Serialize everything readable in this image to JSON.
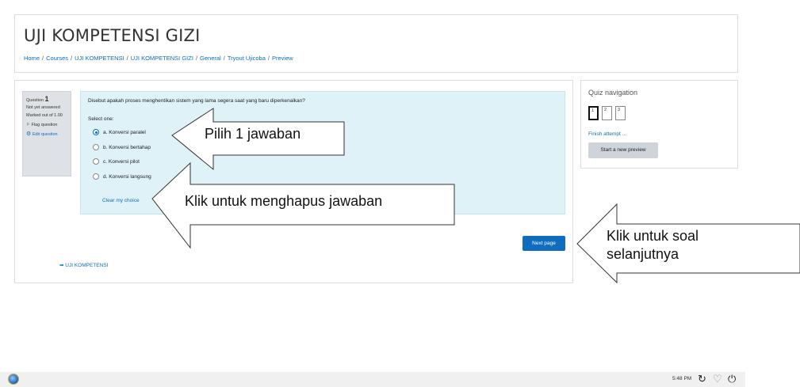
{
  "site": {
    "title": "UJI KOMPETENSI GIZI",
    "breadcrumb": [
      "Home",
      "Courses",
      "UJI KOMPETENSI",
      "UJI KOMPETENSI GIZI",
      "General",
      "Tryout Ujicoba",
      "Preview"
    ]
  },
  "question_info": {
    "label": "Question",
    "number": "1",
    "status": "Not yet answered",
    "marked_out_of": "Marked out of 1.00",
    "flag_label": "Flag question",
    "edit_label": "Edit question"
  },
  "question": {
    "text": "Disebut apakah proses menghentikan sistem yang lama segera saat yang baru diperkenalkan?",
    "select_one": "Select one:",
    "options": [
      {
        "label": "a. Konversi paralel",
        "selected": true
      },
      {
        "label": "b. Konversi bertahap",
        "selected": false
      },
      {
        "label": "c. Konversi pilot",
        "selected": false
      },
      {
        "label": "d. Konversi langsung",
        "selected": false
      }
    ],
    "clear_choice": "Clear my choice"
  },
  "buttons": {
    "next_page": "Next page",
    "return_link": "➡ UJI KOMPETENSI"
  },
  "quiz_nav": {
    "title": "Quiz navigation",
    "pages": [
      "1",
      "2",
      "3"
    ],
    "current_page": "1",
    "finish_attempt": "Finish attempt ...",
    "start_new_preview": "Start a new preview"
  },
  "annotations": {
    "callout_1": "Pilih 1 jawaban",
    "callout_2": "Klik untuk menghapus jawaban",
    "callout_3_line1": "Klik untuk soal",
    "callout_3_line2": "selanjutnya"
  },
  "taskbar": {
    "clock": "5:48 PM"
  },
  "colors": {
    "link": "#0f6cbf",
    "formulation_bg": "#def2f8",
    "info_bg": "#dee2e6",
    "primary_button": "#0f6cbf",
    "secondary_button": "#ced4da"
  },
  "icons": {
    "flag": "flag-icon",
    "edit": "gear-icon",
    "start": "start-orb-icon",
    "refresh": "refresh-icon",
    "heart": "heart-icon",
    "power": "power-icon"
  }
}
